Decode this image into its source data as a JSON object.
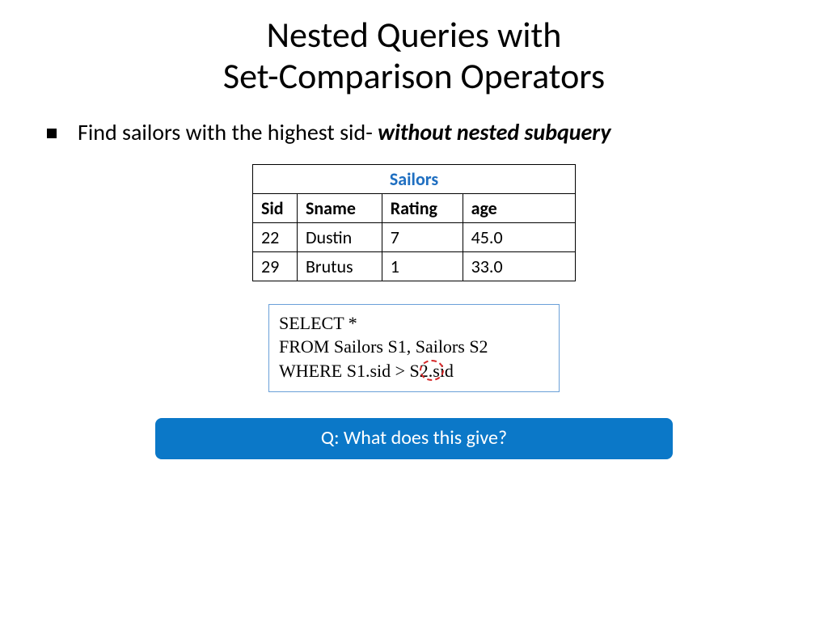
{
  "title_line1": "Nested Queries with",
  "title_line2": "Set-Comparison Operators",
  "bullet": {
    "prefix": "Find sailors with the highest sid- ",
    "emph": "without nested subquery"
  },
  "table": {
    "caption": "Sailors",
    "headers": [
      "Sid",
      "Sname",
      "Rating",
      "age"
    ],
    "rows": [
      [
        "22",
        "Dustin",
        "7",
        "45.0"
      ],
      [
        "29",
        "Brutus",
        "1",
        "33.0"
      ]
    ]
  },
  "sql": {
    "line1_kw": "SELECT",
    "line1_rest": "  *",
    "line2_kw": "FROM",
    "line2_rest": "  Sailors S1, Sailors S2",
    "line3_kw": "WHERE",
    "line3_rest": "  S1.sid > S2.sid"
  },
  "question": "Q: What does this give?"
}
